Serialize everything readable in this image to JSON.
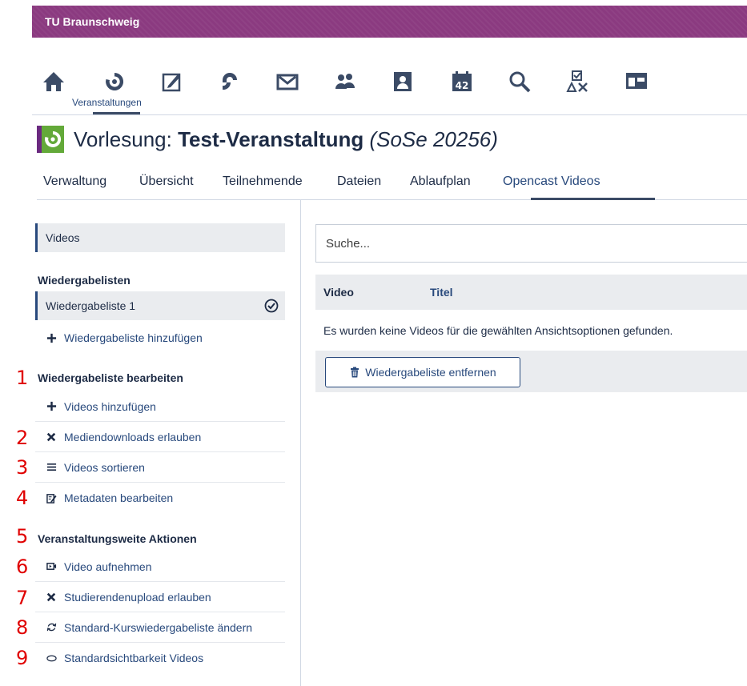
{
  "topbar": {
    "brand": "TU Braunschweig"
  },
  "nav": {
    "icons": [
      "home-icon",
      "courses-icon",
      "messages-icon",
      "community-icon",
      "mail-icon",
      "people-icon",
      "profile-icon",
      "calendar-icon",
      "search-icon",
      "tools-icon",
      "layout-icon"
    ],
    "calendar_day": "42",
    "active_label": "Veranstaltungen"
  },
  "course": {
    "type": "Vorlesung:",
    "name": "Test-Veranstaltung",
    "semester": "(SoSe 20256)"
  },
  "tabs": [
    "Verwaltung",
    "Übersicht",
    "Teilnehmende",
    "Dateien",
    "Ablaufplan",
    "Opencast Videos"
  ],
  "sidebar": {
    "videos": "Videos",
    "playlists_heading": "Wiedergabelisten",
    "playlist_1": "Wiedergabeliste 1",
    "add_playlist": "Wiedergabeliste hinzufügen",
    "edit_heading": "Wiedergabeliste bearbeiten",
    "add_videos": "Videos hinzufügen",
    "allow_downloads": "Mediendownloads erlauben",
    "sort_videos": "Videos sortieren",
    "edit_metadata": "Metadaten bearbeiten",
    "course_heading": "Veranstaltungsweite Aktionen",
    "record_video": "Video aufnehmen",
    "allow_student_upload": "Studierendenupload erlauben",
    "change_default_playlist": "Standard-Kurswiedergabeliste ändern",
    "default_visibility": "Standardsichtbarkeit Videos"
  },
  "annotations": [
    "1",
    "2",
    "3",
    "4",
    "5",
    "6",
    "7",
    "8",
    "9"
  ],
  "main": {
    "search_placeholder": "Suche...",
    "col_video": "Video",
    "col_title": "Titel",
    "empty_message": "Es wurden keine Videos für die gewählten Ansichtsoptionen gefunden.",
    "remove_playlist": "Wiedergabeliste entfernen"
  },
  "colors": {
    "topbar": "#8b3a80",
    "link": "#28497c",
    "course_logo": "#63a939",
    "annotation": "#e00000"
  }
}
